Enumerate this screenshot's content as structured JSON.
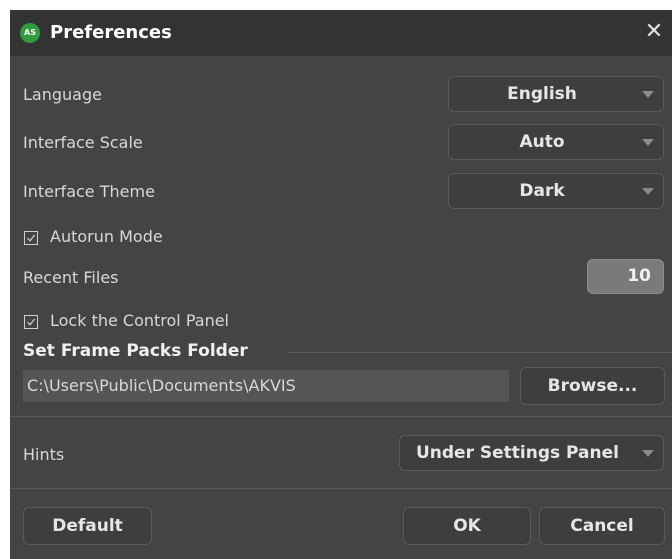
{
  "window": {
    "logo_text": "AS",
    "title": "Preferences",
    "close_glyph": "✕"
  },
  "settings": {
    "language": {
      "label": "Language",
      "value": "English"
    },
    "interface_scale": {
      "label": "Interface Scale",
      "value": "Auto"
    },
    "interface_theme": {
      "label": "Interface Theme",
      "value": "Dark"
    },
    "autorun_mode": {
      "label": "Autorun Mode",
      "checked": true
    },
    "recent_files": {
      "label": "Recent Files",
      "value": "10"
    },
    "lock_control_panel": {
      "label": "Lock the Control Panel",
      "checked": true
    }
  },
  "frame_packs": {
    "section_title": "Set Frame Packs Folder",
    "path": "C:\\Users\\Public\\Documents\\AKVIS",
    "browse_label": "Browse..."
  },
  "hints": {
    "label": "Hints",
    "value": "Under Settings Panel"
  },
  "footer": {
    "default_label": "Default",
    "ok_label": "OK",
    "cancel_label": "Cancel"
  },
  "icons": {
    "logo": "akvis-as-logo-icon",
    "close": "close-icon",
    "dropdown": "chevron-down-icon",
    "checkbox": "checkmark-icon"
  },
  "colors": {
    "dialog_bg": "#444444",
    "titlebar_bg": "#333333",
    "logo_green": "#2e9d3e"
  }
}
